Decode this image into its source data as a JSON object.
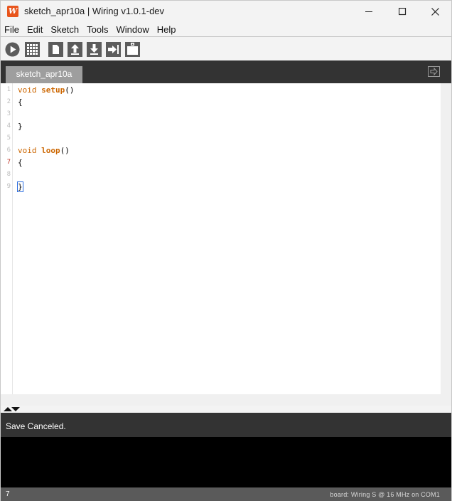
{
  "window": {
    "title": "sketch_apr10a | Wiring v1.0.1-dev",
    "app_icon_letter": "W",
    "controls": [
      "minimize-icon",
      "maximize-icon",
      "close-icon"
    ]
  },
  "menu": {
    "items": [
      "File",
      "Edit",
      "Sketch",
      "Tools",
      "Window",
      "Help"
    ]
  },
  "toolbar": {
    "buttons": [
      "run-icon",
      "stop-icon",
      "new-icon",
      "open-icon",
      "save-icon",
      "upload-icon",
      "serial-monitor-icon"
    ]
  },
  "tabs": {
    "items": [
      {
        "label": "sketch_apr10a",
        "active": true
      }
    ],
    "menu_icon": "tab-menu-icon"
  },
  "editor": {
    "line_numbers": [
      "1",
      "2",
      "3",
      "4",
      "5",
      "6",
      "7",
      "8",
      "9"
    ],
    "current_line": "7",
    "lines": [
      {
        "kw": "void",
        "fn": "setup",
        "rest": "()"
      },
      {
        "text": "{"
      },
      {
        "text": ""
      },
      {
        "text": "}"
      },
      {
        "text": ""
      },
      {
        "kw": "void",
        "fn": "loop",
        "rest": "()"
      },
      {
        "text": "{"
      },
      {
        "text": ""
      },
      {
        "text": "}"
      }
    ],
    "keyword_color": "#cc6600"
  },
  "status": {
    "message": "Save Canceled."
  },
  "footer": {
    "line_number": "7",
    "board": "board: Wiring S @ 16 MHz on COM1"
  },
  "colors": {
    "chrome_dark": "#333333",
    "tab": "#9e9e9e",
    "console": "#000000",
    "footer": "#5a5a5a"
  }
}
